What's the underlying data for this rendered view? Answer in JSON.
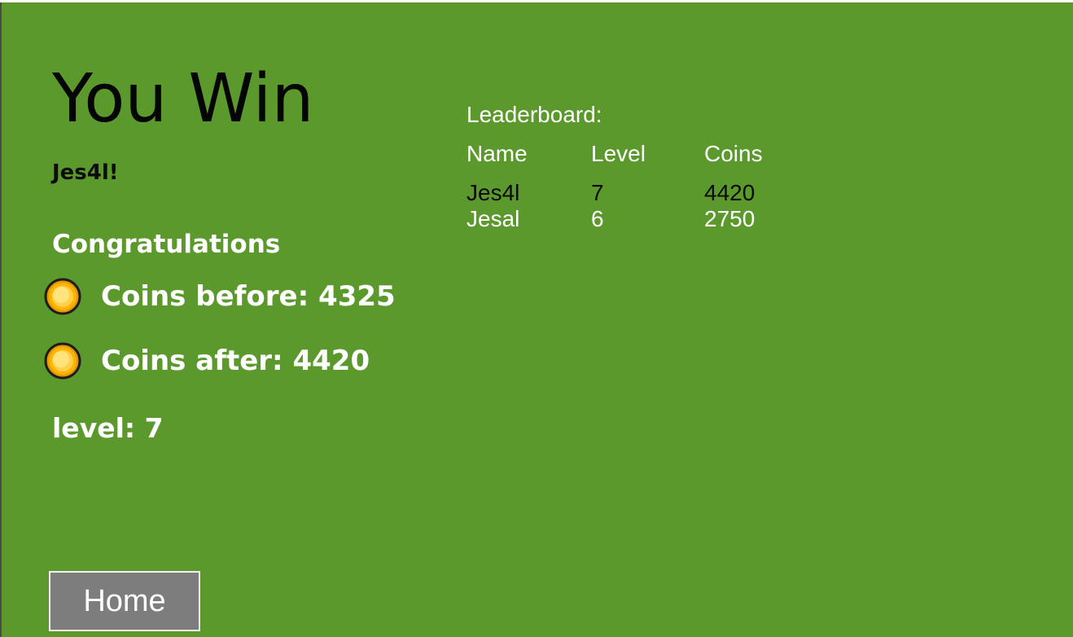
{
  "result": {
    "title": "You Win",
    "player_name": "Jes4l!",
    "congratulations": "Congratulations",
    "coins_before": "Coins before: 4325",
    "coins_after": "Coins after: 4420",
    "level": "level: 7"
  },
  "leaderboard": {
    "title": "Leaderboard:",
    "columns": [
      "Name",
      "Level",
      "Coins"
    ],
    "rows": [
      {
        "name": "Jes4l",
        "level": "7",
        "coins": "4420"
      },
      {
        "name": "Jesal",
        "level": "6",
        "coins": "2750"
      }
    ]
  },
  "buttons": {
    "home": "Home"
  },
  "icons": {
    "coin": "coin-icon"
  },
  "colors": {
    "background": "#5b992d",
    "button": "#7d7d7d",
    "coin": "#f7a600"
  }
}
